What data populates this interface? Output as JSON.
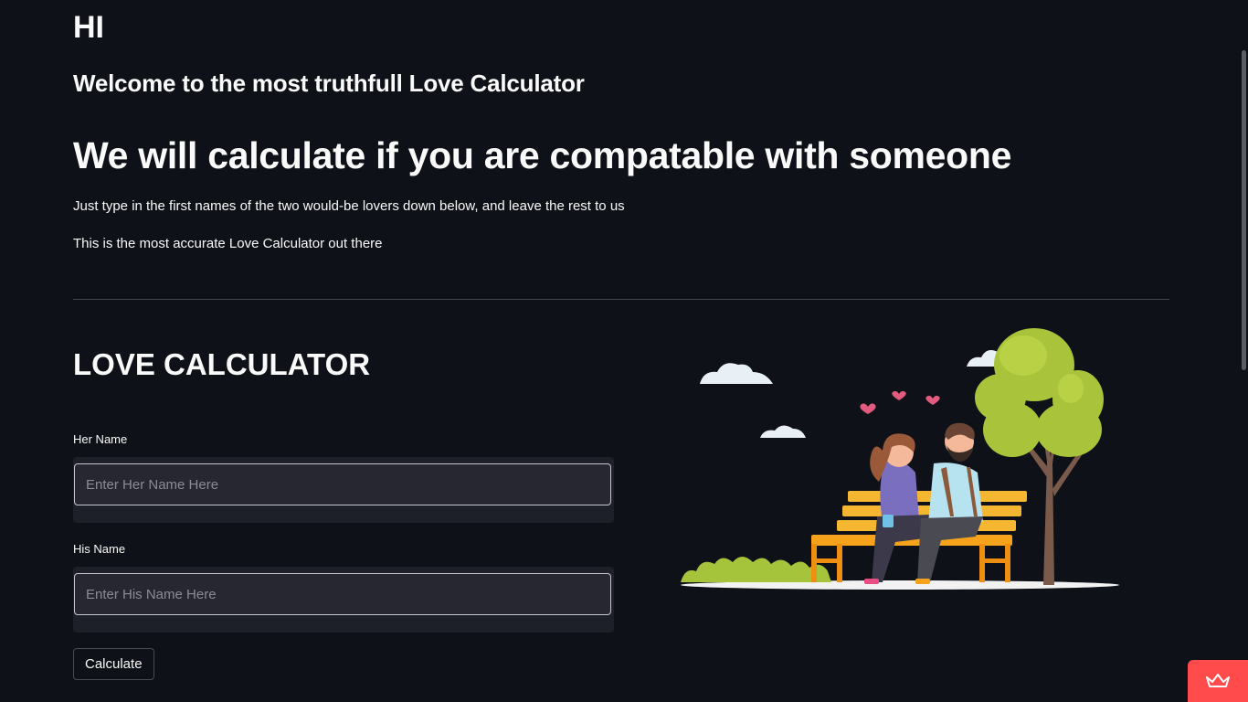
{
  "header": {
    "title": "HI",
    "subtitle": "Welcome to the most truthfull Love Calculator",
    "headline": "We will calculate if you are compatable with someone",
    "paragraph1": "Just type in the first names of the two would-be lovers down below, and leave the rest to us",
    "paragraph2": "This is the most accurate Love Calculator out there"
  },
  "calculator": {
    "title": "LOVE CALCULATOR",
    "her_label": "Her Name",
    "her_placeholder": "Enter Her Name Here",
    "her_value": "",
    "his_label": "His Name",
    "his_placeholder": "Enter His Name Here",
    "his_value": "",
    "button_label": "Calculate"
  },
  "icons": {
    "illustration": "couple-on-bench-illustration",
    "badge": "crown-icon"
  },
  "colors": {
    "background": "#0e1117",
    "input_bg": "#262730",
    "badge": "#ff4b4b"
  }
}
